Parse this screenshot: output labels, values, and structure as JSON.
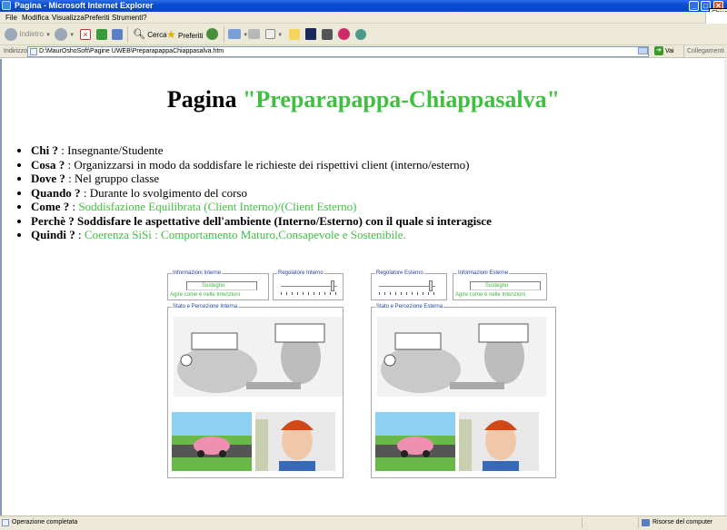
{
  "window": {
    "title": "Pagina - Microsoft Internet Explorer",
    "tooltip": "Chiudi"
  },
  "menu": [
    "File",
    "Modifica",
    "Visualizza",
    "Preferiti",
    "Strumenti",
    "?"
  ],
  "toolbar": {
    "back": "Indietro",
    "search": "Cerca",
    "favorites": "Preferiti"
  },
  "address": {
    "label": "Indirizzo",
    "value": "D:\\MaurOshoSoft\\Pagine UWEB\\PreparapappaChiappasalva.htm",
    "go": "Vai",
    "links": "Collegamenti"
  },
  "page": {
    "title_prefix": "Pagina ",
    "title_name": "\"Preparapappa-Chiappasalva\"",
    "facts": [
      {
        "key": "Chi ?",
        "sep": " : ",
        "value": "Insegnante/Studente",
        "green": false,
        "bold_value": false
      },
      {
        "key": "Cosa ?",
        "sep": " : ",
        "value": "Organizzarsi in modo da soddisfare le richieste dei rispettivi client (interno/esterno)",
        "green": false,
        "bold_value": false
      },
      {
        "key": "Dove ?",
        "sep": " : ",
        "value": "Nel gruppo classe",
        "green": false,
        "bold_value": false
      },
      {
        "key": "Quando ?",
        "sep": " : ",
        "value": "Durante lo svolgimento del corso",
        "green": false,
        "bold_value": false
      },
      {
        "key": "Come ?",
        "sep": " : ",
        "value": "Soddisfazione Equilibrata  (Client Interno)/(Client Esterno)",
        "green": true,
        "bold_value": false
      },
      {
        "key": "Perchè ?",
        "sep": " ",
        "value": "Soddisfare le aspettative dell'ambiente (Interno/Esterno) con il quale si interagisce",
        "green": false,
        "bold_value": true
      },
      {
        "key": "Quindi ?",
        "sep": " : ",
        "value": "Coerenza SiSi : Comportamento Maturo,Consapevole e Sostenibile.",
        "green": true,
        "bold_value": false
      }
    ]
  },
  "applet_left": {
    "info_legend": "Informazioni Interne",
    "info_value": "Sostegno",
    "info_hint": "Agire come è nelle Intenzioni",
    "regulator_legend": "Regolatore Interno",
    "regulator_level": 0.95,
    "state_legend": "Stato e Percezione Interna"
  },
  "applet_right": {
    "regulator_legend": "Regolatore Esterno",
    "regulator_level": 0.95,
    "info_legend": "Informazioni Esterne",
    "info_value": "Sostegno",
    "info_hint": "Agire come è nelle Intenzioni",
    "state_legend": "Stato e Percezione Esterna"
  },
  "statusbar": {
    "left": "Operazione completata",
    "right": "Risorse del computer"
  },
  "colors": {
    "accent_green": "#3fc13f",
    "titlebar_blue": "#0a4bd3",
    "chrome": "#ece9d8"
  }
}
